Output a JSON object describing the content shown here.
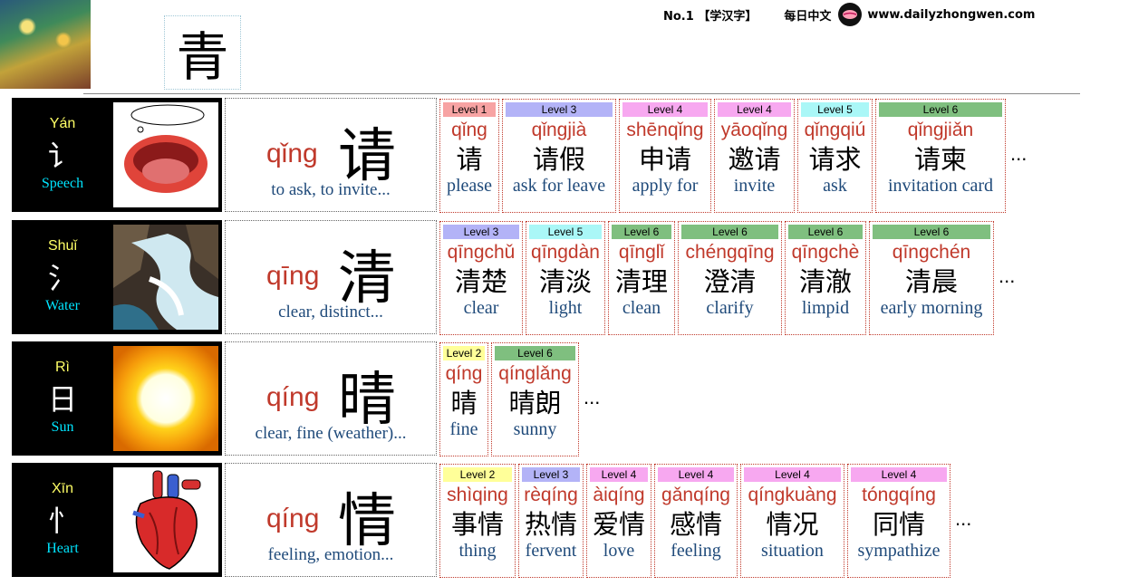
{
  "header": {
    "main_char": "青",
    "site_label": "No.1 【学汉字】",
    "brand": "每日中文",
    "url": "www.dailyzhongwen.com"
  },
  "colors": {
    "level_1": "#f7a3a3",
    "level_2": "#ffff99",
    "level_3": "#b3b3f7",
    "level_4": "#f7a8f0",
    "level_5": "#aaf7f7",
    "level_6": "#7fbf7f"
  },
  "rows": [
    {
      "radical": {
        "pinyin": "Yán",
        "glyph": "讠",
        "meaning": "Speech",
        "picture": "mouth-picture"
      },
      "head": {
        "pinyin": "qǐng",
        "char": "请",
        "def": "to ask, to invite..."
      },
      "more": "...",
      "words": [
        {
          "level": "Level 1",
          "pinyin": "qǐng",
          "hanzi": "请",
          "english": "please"
        },
        {
          "level": "Level 3",
          "pinyin": "qǐngjià",
          "hanzi": "请假",
          "english": "ask for leave"
        },
        {
          "level": "Level 4",
          "pinyin": "shēnqǐng",
          "hanzi": "申请",
          "english": "apply for"
        },
        {
          "level": "Level 4",
          "pinyin": "yāoqǐng",
          "hanzi": "邀请",
          "english": "invite"
        },
        {
          "level": "Level 5",
          "pinyin": "qǐngqiú",
          "hanzi": "请求",
          "english": "ask"
        },
        {
          "level": "Level 6",
          "pinyin": "qǐngjiǎn",
          "hanzi": "请柬",
          "english": "invitation card"
        }
      ]
    },
    {
      "radical": {
        "pinyin": "Shuǐ",
        "glyph": "氵",
        "meaning": "Water",
        "picture": "waterfall-picture"
      },
      "head": {
        "pinyin": "qīng",
        "char": "清",
        "def": "clear, distinct..."
      },
      "more": "...",
      "words": [
        {
          "level": "Level 3",
          "pinyin": "qīngchǔ",
          "hanzi": "清楚",
          "english": "clear"
        },
        {
          "level": "Level 5",
          "pinyin": "qīngdàn",
          "hanzi": "清淡",
          "english": "light"
        },
        {
          "level": "Level 6",
          "pinyin": "qīnglǐ",
          "hanzi": "清理",
          "english": "clean"
        },
        {
          "level": "Level 6",
          "pinyin": "chéngqīng",
          "hanzi": "澄清",
          "english": "clarify"
        },
        {
          "level": "Level 6",
          "pinyin": "qīngchè",
          "hanzi": "清澈",
          "english": "limpid"
        },
        {
          "level": "Level 6",
          "pinyin": "qīngchén",
          "hanzi": "清晨",
          "english": "early morning"
        }
      ]
    },
    {
      "radical": {
        "pinyin": "Rì",
        "glyph": "日",
        "meaning": "Sun",
        "picture": "sun-picture"
      },
      "head": {
        "pinyin": "qíng",
        "char": "晴",
        "def": "clear, fine (weather)..."
      },
      "more": "...",
      "words": [
        {
          "level": "Level 2",
          "pinyin": "qíng",
          "hanzi": "晴",
          "english": "fine"
        },
        {
          "level": "Level 6",
          "pinyin": "qínglǎng",
          "hanzi": "晴朗",
          "english": "sunny"
        }
      ]
    },
    {
      "radical": {
        "pinyin": "Xīn",
        "glyph": "忄",
        "meaning": "Heart",
        "picture": "heart-picture"
      },
      "head": {
        "pinyin": "qíng",
        "char": "情",
        "def": "feeling, emotion..."
      },
      "more": "...",
      "words": [
        {
          "level": "Level 2",
          "pinyin": "shìqing",
          "hanzi": "事情",
          "english": "thing"
        },
        {
          "level": "Level 3",
          "pinyin": "rèqíng",
          "hanzi": "热情",
          "english": "fervent"
        },
        {
          "level": "Level 4",
          "pinyin": "àiqíng",
          "hanzi": "爱情",
          "english": "love"
        },
        {
          "level": "Level 4",
          "pinyin": "gǎnqíng",
          "hanzi": "感情",
          "english": "feeling"
        },
        {
          "level": "Level 4",
          "pinyin": "qíngkuàng",
          "hanzi": "情况",
          "english": "situation"
        },
        {
          "level": "Level 4",
          "pinyin": "tóngqíng",
          "hanzi": "同情",
          "english": "sympathize"
        }
      ]
    }
  ]
}
